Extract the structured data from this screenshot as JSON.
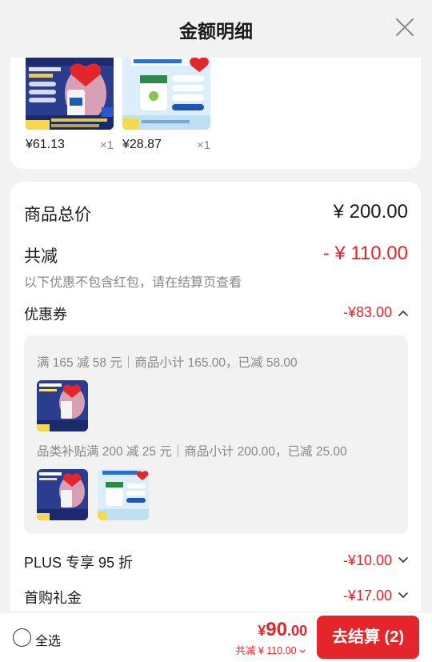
{
  "header": {
    "title": "金额明细"
  },
  "products": [
    {
      "price": "¥61.13",
      "qty": "×1"
    },
    {
      "price": "¥28.87",
      "qty": "×1"
    }
  ],
  "summary": {
    "total_label": "商品总价",
    "total_value": "¥ 200.00",
    "reduce_label": "共减",
    "reduce_value": "- ¥ 110.00",
    "note": "以下优惠不包含红包，请在结算页查看"
  },
  "coupon": {
    "label": "优惠券",
    "value": "-¥83.00",
    "rule1": "满 165 减 58 元｜商品小计 165.00，已减 58.00",
    "rule2": "品类补贴满 200 减 25 元｜商品小计 200.00，已减 25.00"
  },
  "plus": {
    "label": "PLUS 专享 95 折",
    "value": "-¥10.00"
  },
  "first": {
    "label": "首购礼金",
    "value": "-¥17.00"
  },
  "footer": {
    "select_all": "全选",
    "price_symbol": "¥",
    "price_int": "90",
    "price_dec": ".00",
    "reduce_note": "共减 ¥ 110.00",
    "checkout": "去结算 (2)"
  },
  "colors": {
    "accent": "#e4262c",
    "muted": "#888888"
  }
}
